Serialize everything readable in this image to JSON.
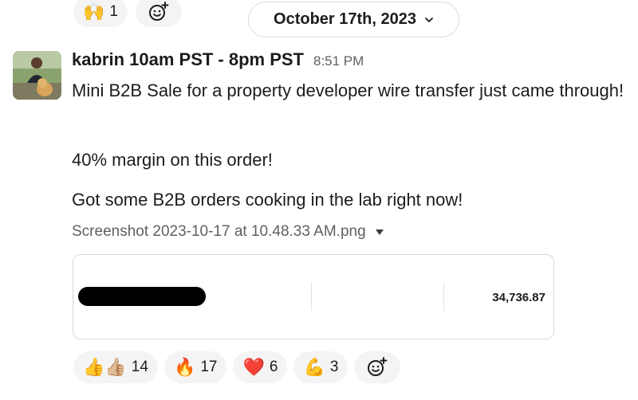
{
  "top_reactions": [
    {
      "emoji": "🙌",
      "count": "1"
    }
  ],
  "date_divider": {
    "label": "October 17th, 2023"
  },
  "message": {
    "sender": "kabrin 10am PST - 8pm PST",
    "time": "8:51 PM",
    "paragraphs": [
      "Mini B2B Sale for a property developer wire transfer just came through!",
      "40% margin on this order!",
      "Got some B2B orders cooking in the lab right now!"
    ],
    "attachment": {
      "filename": "Screenshot 2023-10-17 at 10.48.33 AM.png",
      "amount": "34,736.87"
    }
  },
  "reactions": [
    {
      "emoji": "👍👍🏼",
      "count": "14"
    },
    {
      "emoji": "🔥",
      "count": "17"
    },
    {
      "emoji": "❤️",
      "count": "6"
    },
    {
      "emoji": "💪",
      "count": "3"
    }
  ],
  "icons": {
    "add_reaction": "add-reaction-icon",
    "chevron": "chevron-down-icon",
    "file_caret": "caret-down-icon"
  }
}
